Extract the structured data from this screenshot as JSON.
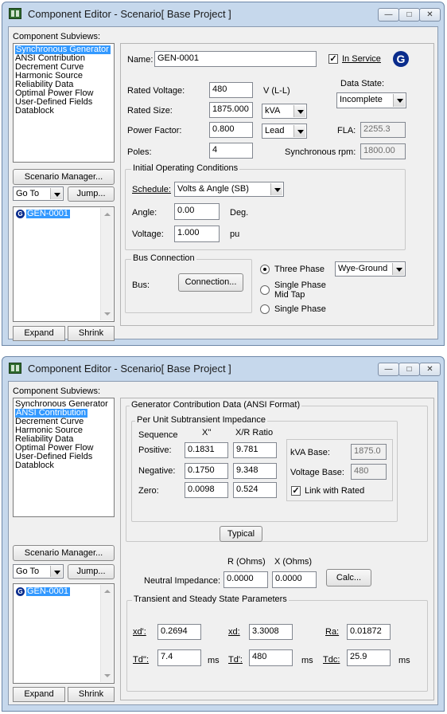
{
  "window1": {
    "title": "Component Editor  - Scenario[ Base Project ]",
    "subviews_label": "Component Subviews:",
    "subviews": [
      "Synchronous Generator",
      "ANSI Contribution",
      "Decrement Curve",
      "Harmonic Source",
      "Reliability Data",
      "Optimal Power Flow",
      "User-Defined Fields",
      "Datablock"
    ],
    "selected_subview": "Synchronous Generator",
    "scenario_manager": "Scenario Manager...",
    "goto_value": "Go To",
    "jump": "Jump...",
    "tree_item": "GEN-0001",
    "expand": "Expand",
    "shrink": "Shrink",
    "name_label": "Name:",
    "name_value": "GEN-0001",
    "in_service_label": "In Service",
    "in_service_checked": true,
    "badge_letter": "G",
    "tree_badge_letter": "G",
    "rated_voltage_label": "Rated Voltage:",
    "rated_voltage_value": "480",
    "rated_voltage_unit": "V (L-L)",
    "data_state_label": "Data State:",
    "data_state_value": "Incomplete",
    "rated_size_label": "Rated Size:",
    "rated_size_value": "1875.000",
    "rated_size_unit": "kVA",
    "power_factor_label": "Power Factor:",
    "power_factor_value": "0.800",
    "power_factor_type": "Lead",
    "fla_label": "FLA:",
    "fla_value": "2255.3",
    "poles_label": "Poles:",
    "poles_value": "4",
    "sync_rpm_label": "Synchronous rpm:",
    "sync_rpm_value": "1800.00",
    "ioc_title": "Initial Operating Conditions",
    "schedule_label": "Schedule:",
    "schedule_value": "Volts & Angle (SB)",
    "angle_label": "Angle:",
    "angle_value": "0.00",
    "angle_unit": "Deg.",
    "voltage_label": "Voltage:",
    "voltage_value": "1.000",
    "voltage_unit": "pu",
    "bus_conn_title": "Bus Connection",
    "bus_label": "Bus:",
    "connection_btn": "Connection...",
    "three_phase": "Three Phase",
    "single_phase_mid": "Single Phase",
    "single_phase_mid2": "Mid Tap",
    "single_phase": "Single Phase",
    "grounding_value": "Wye-Ground"
  },
  "window2": {
    "title": "Component Editor  - Scenario[ Base Project ]",
    "subviews_label": "Component Subviews:",
    "subviews": [
      "Synchronous Generator",
      "ANSI Contribution",
      "Decrement Curve",
      "Harmonic Source",
      "Reliability Data",
      "Optimal Power Flow",
      "User-Defined Fields",
      "Datablock"
    ],
    "selected_subview": "ANSI Contribution",
    "scenario_manager": "Scenario Manager...",
    "goto_value": "Go To",
    "jump": "Jump...",
    "tree_item": "GEN-0001",
    "tree_badge_letter": "G",
    "expand": "Expand",
    "shrink": "Shrink",
    "gcd_title": "Generator Contribution Data (ANSI Format)",
    "pusi_title": "Per Unit Subtransient Impedance",
    "col_sequence": "Sequence",
    "col_x": "X''",
    "col_xr": "X/R Ratio",
    "positive_label": "Positive:",
    "positive_x": "0.1831",
    "positive_xr": "9.781",
    "negative_label": "Negative:",
    "negative_x": "0.1750",
    "negative_xr": "9.348",
    "zero_label": "Zero:",
    "zero_x": "0.0098",
    "zero_xr": "0.524",
    "kva_base_label": "kVA Base:",
    "kva_base_value": "1875.0",
    "voltage_base_label": "Voltage Base:",
    "voltage_base_value": "480",
    "link_rated_label": "Link with Rated",
    "link_rated_checked": true,
    "typical_btn": "Typical",
    "r_ohms_label": "R (Ohms)",
    "x_ohms_label": "X (Ohms)",
    "neutral_label": "Neutral Impedance:",
    "neutral_r": "0.0000",
    "neutral_x": "0.0000",
    "calc_btn": "Calc...",
    "tssp_title": "Transient and Steady State Parameters",
    "xd1_label": "xd':",
    "xd1_value": "0.2694",
    "xd_label": "xd:",
    "xd_value": "3.3008",
    "ra_label": "Ra:",
    "ra_value": "0.01872",
    "td2_label": "Td'':",
    "td2_value": "7.4",
    "td2_unit": "ms",
    "td1_label": "Td':",
    "td1_value": "480",
    "td1_unit": "ms",
    "tdc_label": "Tdc:",
    "tdc_value": "25.9",
    "tdc_unit": "ms"
  },
  "colors": {
    "selection": "#3399ff",
    "badge": "#0a2c8c",
    "window_frame": "#c6d8ec"
  }
}
